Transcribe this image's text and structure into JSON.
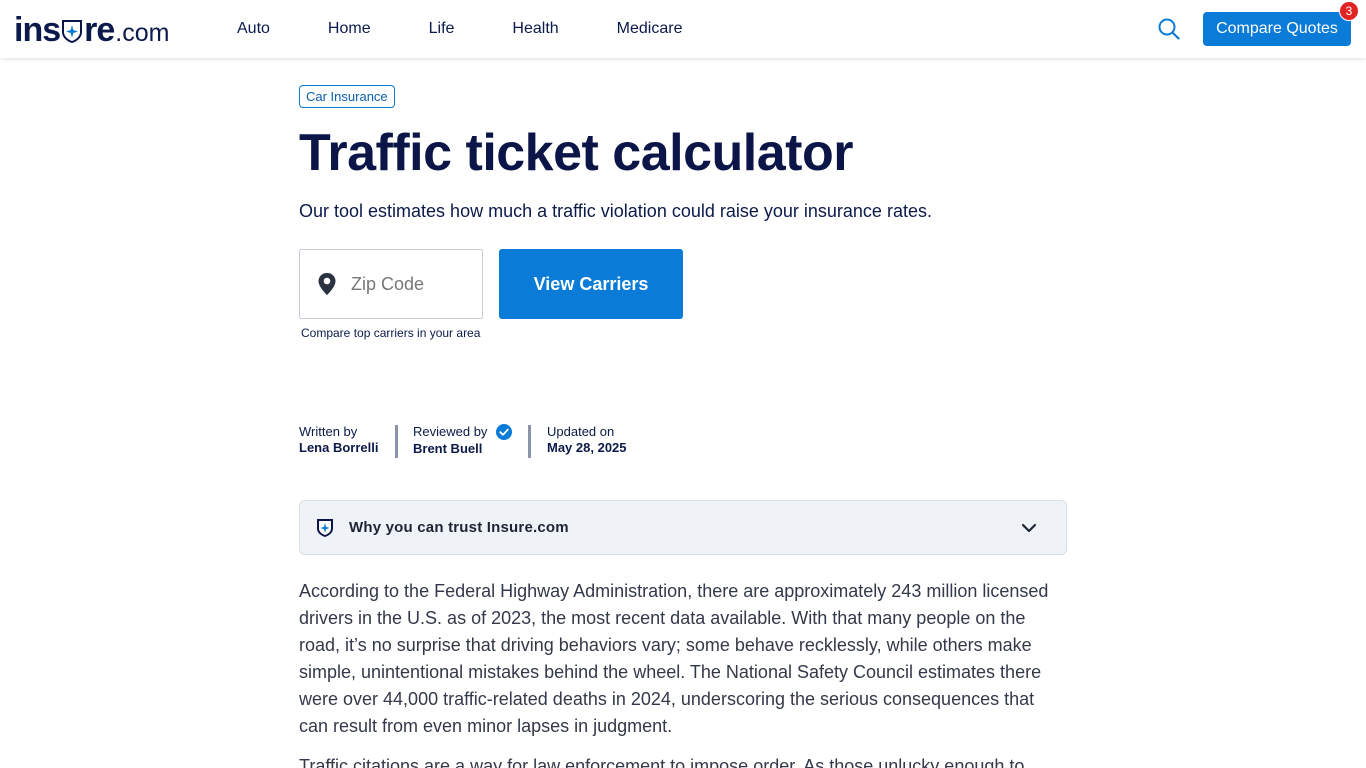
{
  "brand": {
    "logo_main_left": "ins",
    "logo_main_right": "re",
    "logo_tld": ".com"
  },
  "nav": {
    "items": [
      "Auto",
      "Home",
      "Life",
      "Health",
      "Medicare"
    ]
  },
  "header": {
    "compare_label": "Compare Quotes",
    "compare_badge": "3",
    "search_icon": "search-icon"
  },
  "article": {
    "tag": "Car Insurance",
    "title": "Traffic ticket calculator",
    "subtitle": "Our tool estimates how much a traffic violation could raise your insurance rates."
  },
  "zip_form": {
    "placeholder": "Zip Code",
    "value": "",
    "button_label": "View Carriers",
    "help_text": "Compare top carriers in your area"
  },
  "byline": {
    "written_label": "Written by",
    "written_name": "Lena Borrelli",
    "reviewed_label": "Reviewed by",
    "reviewed_name": "Brent Buell",
    "updated_label": "Updated on",
    "updated_date": "May 28, 2025"
  },
  "trust": {
    "label": "Why you can trust Insure.com"
  },
  "body": {
    "para1": "According to the Federal Highway Administration, there are approximately 243 million licensed drivers in the U.S. as of 2023, the most recent data available. With that many people on the road, it’s no surprise that driving behaviors vary; some behave recklessly, while others make simple, unintentional mistakes behind the wheel. The National Safety Council estimates there were over 44,000 traffic-related deaths in 2024, underscoring the serious consequences that can result from even minor lapses in judgment.",
    "para2": "Traffic citations are a way for law enforcement to impose order. As those unlucky enough to"
  },
  "colors": {
    "primary": "#0a7bd6",
    "navy": "#0b1547",
    "badge": "#e02424"
  }
}
